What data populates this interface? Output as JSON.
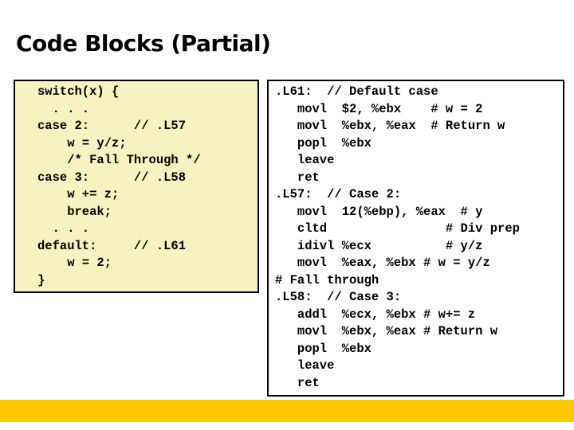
{
  "slide": {
    "title": "Code Blocks (Partial)"
  },
  "c_code": {
    "lines": [
      "switch(x) {",
      "  . . .",
      "case 2:      // .L57",
      "    w = y/z;",
      "    /* Fall Through */",
      "case 3:      // .L58",
      "    w += z;",
      "    break;",
      "  . . .",
      "default:     // .L61",
      "    w = 2;",
      "}"
    ]
  },
  "asm_code": {
    "lines": [
      ".L61:  // Default case",
      "   movl  $2, %ebx    # w = 2",
      "   movl  %ebx, %eax  # Return w",
      "   popl  %ebx",
      "   leave",
      "   ret",
      ".L57:  // Case 2:",
      "   movl  12(%ebp), %eax  # y",
      "   cltd                # Div prep",
      "   idivl %ecx          # y/z",
      "   movl  %eax, %ebx # w = y/z",
      "# Fall through",
      ".L58:  // Case 3:",
      "   addl  %ecx, %ebx # w+= z",
      "   movl  %ebx, %eax # Return w",
      "   popl  %ebx",
      "   leave",
      "   ret"
    ]
  },
  "colors": {
    "c_box_background": "#f7f3c0",
    "footer_accent": "#ffc700"
  }
}
